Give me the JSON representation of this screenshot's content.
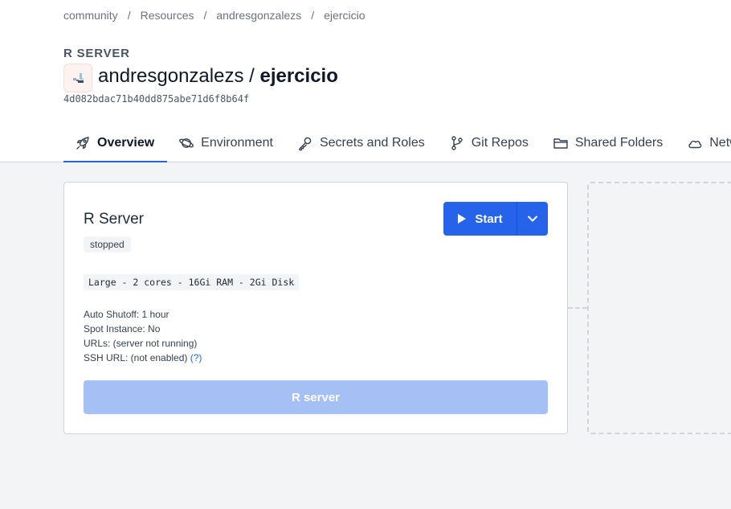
{
  "breadcrumb": [
    "community",
    "Resources",
    "andresgonzalezs",
    "ejercicio"
  ],
  "breadcrumb_separator": "/",
  "resource_kind": "R SERVER",
  "title": {
    "owner": "andresgonzalezs",
    "separator": "/",
    "name": "ejercicio"
  },
  "resource_hash": "4d082bdac71b40dd875abe71d6f8b64f",
  "tabs": [
    {
      "label": "Overview",
      "icon": "rocket-icon",
      "active": true
    },
    {
      "label": "Environment",
      "icon": "planet-icon",
      "active": false
    },
    {
      "label": "Secrets and Roles",
      "icon": "key-icon",
      "active": false
    },
    {
      "label": "Git Repos",
      "icon": "git-branch-icon",
      "active": false
    },
    {
      "label": "Shared Folders",
      "icon": "folder-icon",
      "active": false
    },
    {
      "label": "Netw",
      "icon": "cloud-icon",
      "active": false
    }
  ],
  "server_card": {
    "title": "R Server",
    "status": "stopped",
    "spec": "Large - 2 cores - 16Gi RAM - 2Gi Disk",
    "auto_shutoff": "Auto Shutoff: 1 hour",
    "spot_instance": "Spot Instance: No",
    "urls": "URLs: (server not running)",
    "ssh_url": "SSH URL: (not enabled)",
    "ssh_help_link": "(?)",
    "start_label": "Start",
    "open_label": "R server"
  },
  "colors": {
    "accent": "#2563eb",
    "disabled_button": "#a5c0f4",
    "page_background": "#f3f4f6"
  }
}
